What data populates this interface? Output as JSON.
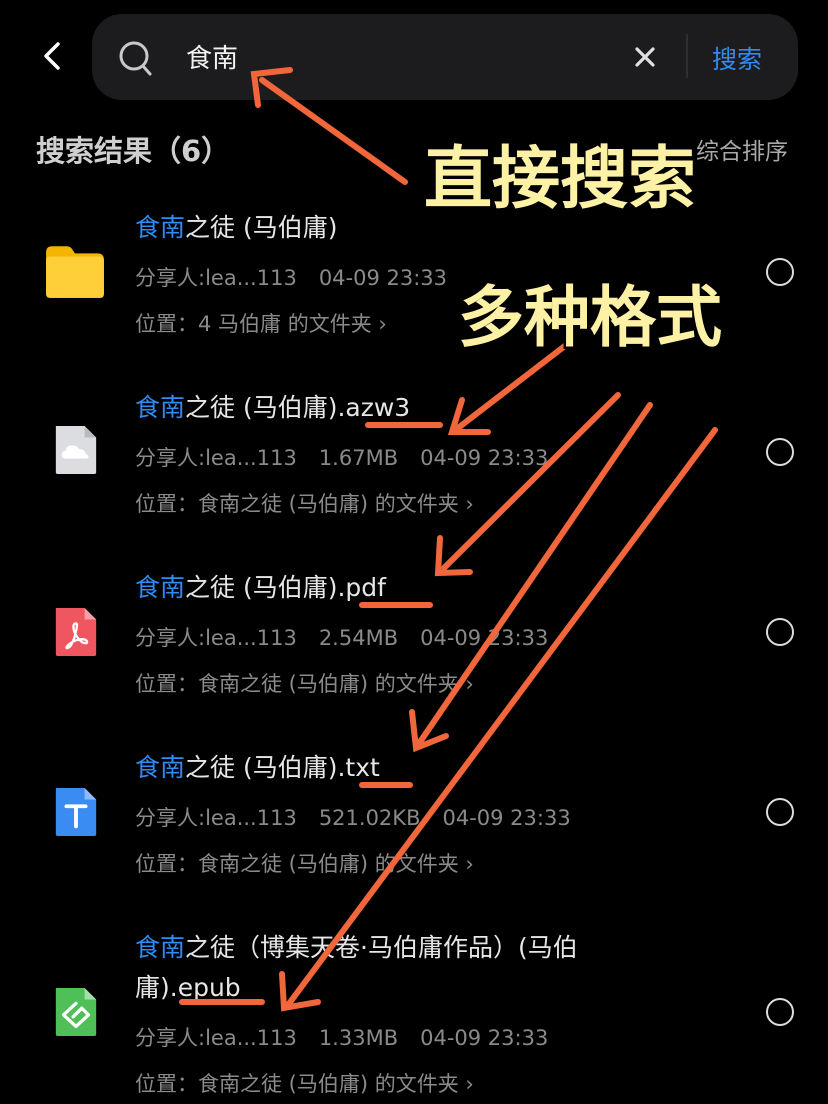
{
  "search": {
    "query": "食南",
    "button": "搜索"
  },
  "results": {
    "title": "搜索结果（6）",
    "sort": "综合排序"
  },
  "items": [
    {
      "hl": "食南",
      "rest": "之徒 (马伯庸)",
      "rest2": "",
      "sharer": "分享人:lea...113",
      "size": "",
      "time": "04-09 23:33",
      "location": "位置：4 马伯庸 的文件夹 ›",
      "icon": "folder-icon"
    },
    {
      "hl": "食南",
      "rest": "之徒 (马伯庸).azw3",
      "rest2": "",
      "sharer": "分享人:lea...113",
      "size": "1.67MB",
      "time": "04-09 23:33",
      "location": "位置：食南之徒 (马伯庸) 的文件夹 ›",
      "icon": "cloud-file-icon"
    },
    {
      "hl": "食南",
      "rest": "之徒 (马伯庸).pdf",
      "rest2": "",
      "sharer": "分享人:lea...113",
      "size": "2.54MB",
      "time": "04-09 23:33",
      "location": "位置：食南之徒 (马伯庸) 的文件夹 ›",
      "icon": "pdf-icon"
    },
    {
      "hl": "食南",
      "rest": "之徒 (马伯庸).txt",
      "rest2": "",
      "sharer": "分享人:lea...113",
      "size": "521.02KB",
      "time": "04-09 23:33",
      "location": "位置：食南之徒 (马伯庸) 的文件夹 ›",
      "icon": "txt-icon"
    },
    {
      "hl": "食南",
      "rest": "之徒（博集天卷·马伯庸作品）(马伯",
      "rest2": "庸).epub",
      "sharer": "分享人:lea...113",
      "size": "1.33MB",
      "time": "04-09 23:33",
      "location": "位置：食南之徒 (马伯庸) 的文件夹 ›",
      "icon": "epub-icon"
    }
  ],
  "annotations": {
    "direct_search": "直接搜索",
    "multi_format": "多种格式"
  },
  "colors": {
    "accent": "#2f8cf5",
    "annotation_arrow": "#f2663b",
    "annotation_text": "#fdf1a6"
  }
}
